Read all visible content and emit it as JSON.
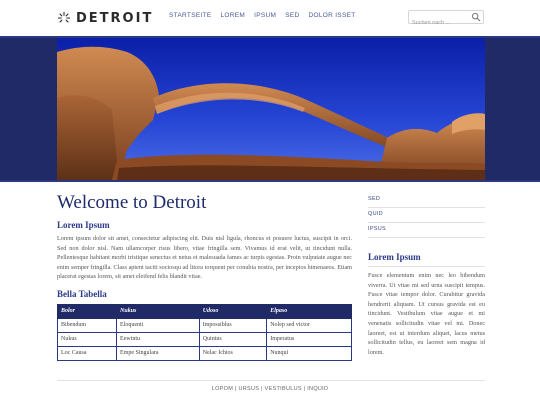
{
  "header": {
    "logo_text": "DETROIT",
    "nav": [
      "STARTSEITE",
      "LOREM",
      "IPSUM",
      "SED",
      "DOLOR ISSET"
    ],
    "search_placeholder": "Suchen nach ...",
    "search_icon": "search-icon"
  },
  "main": {
    "title": "Welcome to Detroit",
    "section_title": "Lorem Ipsum",
    "body": "Lorem ipsum dolor sit amet, consectetur adipiscing elit. Duis nisl ligula, rhoncus et posuere luctus, suscipit in orci. Sed non dolor nisl. Nam ullamcorper risus libero, vitae fringilla sem. Vivamus id erat velit, ut tincidunt nulla. Pellentesque habitant morbi tristique senectus et netus et malesuada fames ac turpis egestas. Proin vulputate augue nec enim semper fringilla. Class aptent taciti sociosqu ad litora torquent per conubia nostra, per inceptos himenaeos. Etiam placerat egestas lorem, sit amet eleifend felis blandit vitae.",
    "table_title": "Bella Tabella",
    "table": {
      "headers": [
        "Bolor",
        "Nukus",
        "Udoso",
        "Elpaso"
      ],
      "rows": [
        [
          "Bibendum",
          "Eloquenti",
          "Impossiblus",
          "Nolep sed victor"
        ],
        [
          "Nukus",
          "Eewintu",
          "Quintus",
          "Imperatus"
        ],
        [
          "Loc Causa",
          "Empe Singulara",
          "Nelac Ichios",
          "Nunqui"
        ]
      ]
    }
  },
  "sidebar": {
    "menu": [
      "SED",
      "QUID",
      "IPSUS"
    ],
    "title": "Lorem Ipsum",
    "text": "Fusce elementum enim nec leo bibendum viverra. Ut vitae mi sed urna suscipit tempus. Fusce vitae tempor dolor. Curabitur gravida hendrerit aliquam. Ut cursus gravida est eu tincidunt. Vestibulum vitae augue et mi venenatis sollicitudin vitae vel mi. Donec laoreet, est ut interdum aliquet, lacus metus sollicitudin tellus, eu laoreet sem magna id lorem."
  },
  "footer": {
    "text": "LOPOM | URSUS | VESTIBULUS | INQUID"
  },
  "colors": {
    "brand_navy": "#1f2a66",
    "link_blue": "#2b3a8a"
  }
}
